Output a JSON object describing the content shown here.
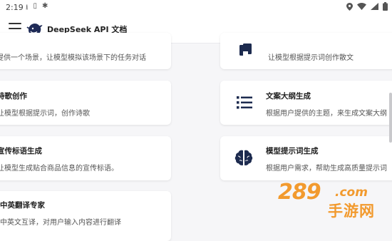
{
  "status_bar": {
    "time": "2:19"
  },
  "app_bar": {
    "title": "DeepSeek API 文档"
  },
  "cards": [
    {
      "title": "",
      "desc": "提供一个场景，让模型模拟该场景下的任务对话"
    },
    {
      "title": "",
      "desc": "让模型根据提示词创作散文"
    },
    {
      "title": "诗歌创作",
      "desc": "让模型根据提示词，创作诗歌"
    },
    {
      "title": "文案大纲生成",
      "desc": "根据用户提供的主题，来生成文案大纲"
    },
    {
      "title": "宣传标语生成",
      "desc": "让模型生成贴合商品信息的宣传标语。"
    },
    {
      "title": "模型提示词生成",
      "desc": "根据用户需求，帮助生成高质量提示词"
    },
    {
      "title": "中英翻译专家",
      "desc": "中英文互译，对用户输入内容进行翻译"
    }
  ],
  "watermark": {
    "number": "289",
    "domain": ".com",
    "text": "手游网"
  },
  "icons": [
    "menu-icon",
    "whale-logo-icon",
    "document-icon",
    "list-icon",
    "brain-icon"
  ]
}
